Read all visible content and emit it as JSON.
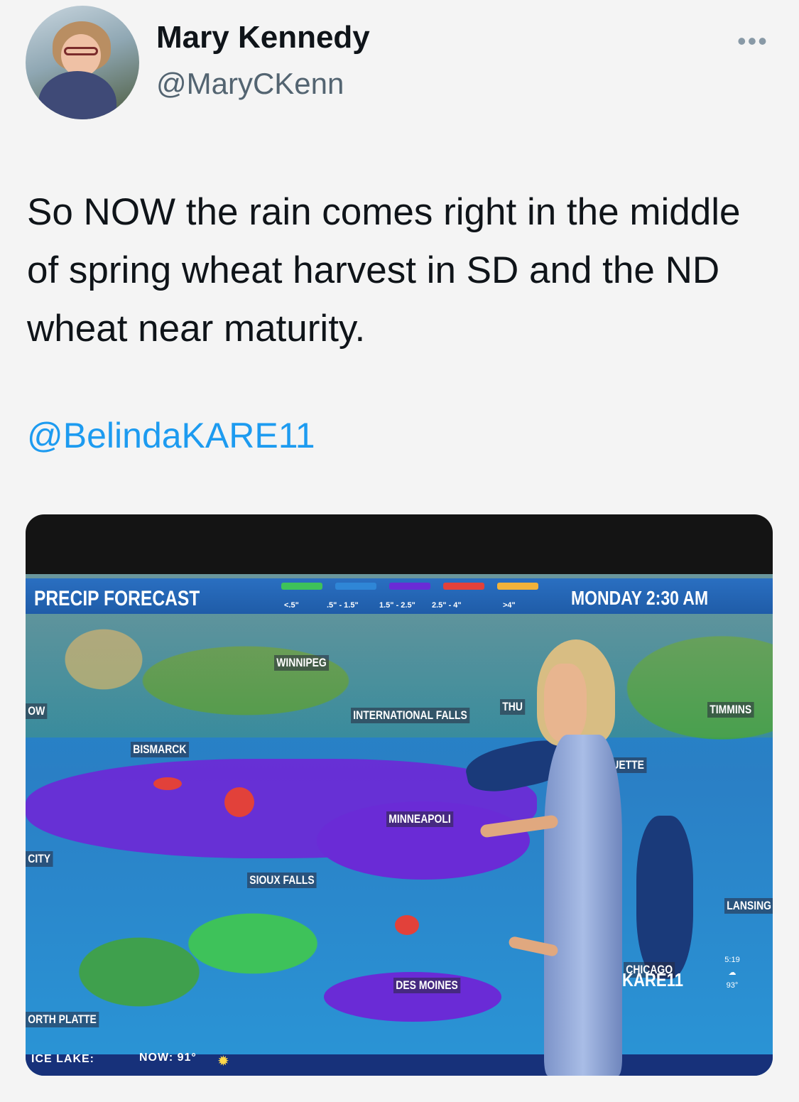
{
  "tweet": {
    "author_name": "Mary Kennedy",
    "author_handle": "@MaryCKenn",
    "more_icon": "more-horizontal-icon",
    "text": "So NOW the rain comes right in the middle of spring wheat harvest in SD and the ND wheat near maturity.",
    "mention": "@BelindaKARE11"
  },
  "media": {
    "screen_title": "PRECIP FORECAST",
    "time": "MONDAY  2:30 AM",
    "legend": [
      {
        "label": "<.5\"",
        "color": "#3ec25a"
      },
      {
        "label": ".5\" - 1.5\"",
        "color": "#2f86d6"
      },
      {
        "label": "1.5\" - 2.5\"",
        "color": "#6a2bd6"
      },
      {
        "label": "2.5\" - 4\"",
        "color": "#e2413a"
      },
      {
        "label": ">4\"",
        "color": "#f2b23a"
      }
    ],
    "cities": {
      "winnipeg": "WINNIPEG",
      "international_falls": "INTERNATIONAL FALLS",
      "thu": "THU",
      "timmins": "TIMMINS",
      "ow": "OW",
      "bismarck": "BISMARCK",
      "uette": "UETTE",
      "minneapolis": "MINNEAPOLI",
      "city": "CITY",
      "sioux_falls": "SIOUX FALLS",
      "lansing": "LANSING",
      "chicago": "CHICAGO",
      "des_moines": "DES MOINES",
      "north_platte": "ORTH PLATTE"
    },
    "logo": "KARE11",
    "corner_time": "5:19",
    "corner_temp": "93°",
    "ticker_location": "ICE LAKE:",
    "ticker_now": "NOW: 91°"
  }
}
